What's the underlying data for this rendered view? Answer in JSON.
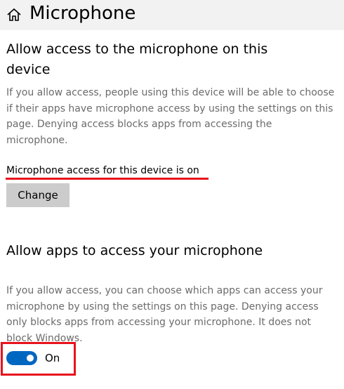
{
  "header": {
    "title": "Microphone",
    "home_icon": "home-icon"
  },
  "device_access": {
    "heading": "Allow access to the microphone on this device",
    "description": "If you allow access, people using this device will be able to choose if their apps have microphone access by using the settings on this page. Denying access blocks apps from accessing the microphone.",
    "status": "Microphone access for this device is on",
    "change_button_label": "Change"
  },
  "app_access": {
    "heading": "Allow apps to access your microphone",
    "description": "If you allow access, you can choose which apps can access your microphone by using the settings on this page. Denying access only blocks apps from accessing your microphone. It does not block Windows.",
    "toggle_state": "On"
  },
  "colors": {
    "accent": "#0067c0",
    "highlight": "#e8121c",
    "header_bg": "#f2f2f2",
    "button_bg": "#cccccc",
    "description_text": "#6b6b6b"
  }
}
